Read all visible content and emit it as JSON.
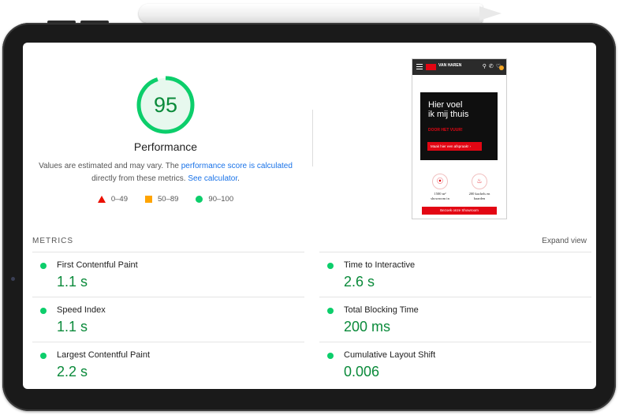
{
  "report": {
    "score": "95",
    "category": "Performance",
    "description_prefix": "Values are estimated and may vary. The ",
    "description_link1": "performance score is calculated",
    "description_middle": " directly from these metrics. ",
    "description_link2": "See calculator",
    "description_suffix": "."
  },
  "legend": [
    {
      "label": "0–49",
      "color": "#eb0f00"
    },
    {
      "label": "50–89",
      "color": "#ffa400"
    },
    {
      "label": "90–100",
      "color": "#0cce6b"
    }
  ],
  "preview": {
    "brand": "VAN HAREN",
    "hero_title": "Hier voel\nik mij thuis",
    "hero_subtitle": "DOOR HET VUUR!",
    "hero_button": "Maak hier een afspraak!  ›",
    "feature1": "1500 m²\nshowroom in",
    "feature2": "200 kachels en\nhaarden",
    "footer_button": "Bezoek onze Showroom"
  },
  "metrics": {
    "title": "METRICS",
    "expand_label": "Expand view",
    "items": [
      {
        "label": "First Contentful Paint",
        "value": "1.1 s"
      },
      {
        "label": "Time to Interactive",
        "value": "2.6 s"
      },
      {
        "label": "Speed Index",
        "value": "1.1 s"
      },
      {
        "label": "Total Blocking Time",
        "value": "200 ms"
      },
      {
        "label": "Largest Contentful Paint",
        "value": "2.2 s"
      },
      {
        "label": "Cumulative Layout Shift",
        "value": "0.006"
      }
    ]
  },
  "colors": {
    "pass": "#0cce6b",
    "pass_text": "#0a8a3a",
    "link": "#1a73e8",
    "brand_red": "#e30613"
  }
}
